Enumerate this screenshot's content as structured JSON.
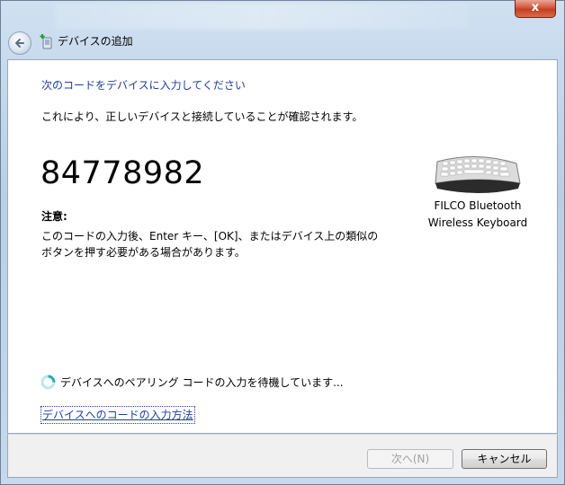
{
  "window": {
    "title": "デバイスの追加",
    "close_label": "x"
  },
  "content": {
    "heading": "次のコードをデバイスに入力してください",
    "description": "これにより、正しいデバイスと接続していることが確認されます。",
    "pairing_code": "84778982",
    "note_title": "注意:",
    "note_line1": "このコードの入力後、Enter キー、[OK]、またはデバイス上の類似の",
    "note_line2": "ボタンを押す必要がある場合があります。",
    "device_name_line1": "FILCO Bluetooth",
    "device_name_line2": "Wireless Keyboard",
    "status_text": "デバイスへのペアリング コードの入力を待機しています...",
    "help_link": "デバイスへのコードの入力方法"
  },
  "footer": {
    "next_label": "次へ(N)",
    "cancel_label": "キャンセル"
  },
  "icons": {
    "back": "back-arrow-icon",
    "title": "add-device-icon",
    "device": "keyboard-icon",
    "spinner": "busy-spinner-icon"
  },
  "colors": {
    "link_blue": "#1f3ea1",
    "close_red": "#c2401f",
    "disabled_text": "#a0a0a0"
  }
}
